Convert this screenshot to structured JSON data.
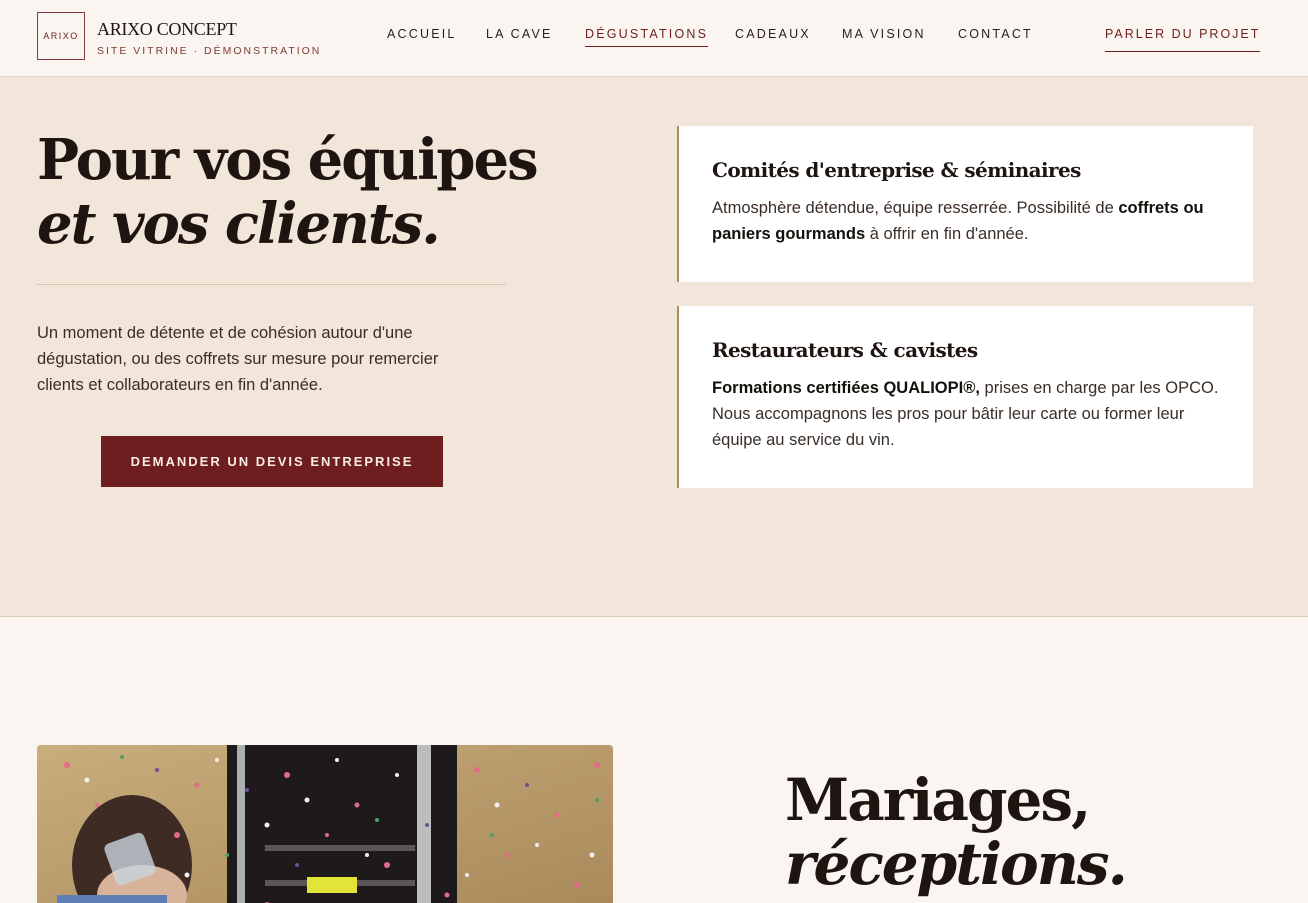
{
  "header": {
    "logo_text": "ARIXO",
    "brand_name": "ARIXO CONCEPT",
    "brand_sub": "SITE VITRINE · DÉMONSTRATION",
    "nav": [
      {
        "label": "ACCUEIL",
        "active": false
      },
      {
        "label": "LA CAVE",
        "active": false
      },
      {
        "label": "DÉGUSTATIONS",
        "active": true
      },
      {
        "label": "CADEAUX",
        "active": false
      },
      {
        "label": "MA VISION",
        "active": false
      },
      {
        "label": "CONTACT",
        "active": false
      }
    ],
    "cta_label": "PARLER DU PROJET"
  },
  "pro_section": {
    "title_line1": "Pour vos équipes",
    "title_line2": "et vos clients.",
    "lead": "Un moment de détente et de cohésion autour d'une dégustation, ou des coffrets sur mesure pour remercier clients et collaborateurs en fin d'année.",
    "button_label": "DEMANDER UN DEVIS ENTREPRISE",
    "cards": [
      {
        "title": "Comités d'entreprise & séminaires",
        "body_before": "Atmosphère détendue, équipe resserrée. Possibilité de ",
        "body_bold": "coffrets ou paniers gourmands",
        "body_after": " à offrir en fin d'année."
      },
      {
        "title": "Restaurateurs & cavistes",
        "body_before": "",
        "body_bold": "Formations certifiées QUALIOPI®,",
        "body_after": " prises en charge par les OPCO. Nous accompagnons les pros pour bâtir leur carte ou former leur équipe au service du vin."
      }
    ]
  },
  "mariages_section": {
    "title_line1": "Mariages,",
    "title_line2": "réceptions."
  },
  "colors": {
    "accent": "#6e1e1e",
    "gold_border": "#b08a4e",
    "section_bg": "#f2e6da",
    "page_bg": "#faf5f0"
  }
}
